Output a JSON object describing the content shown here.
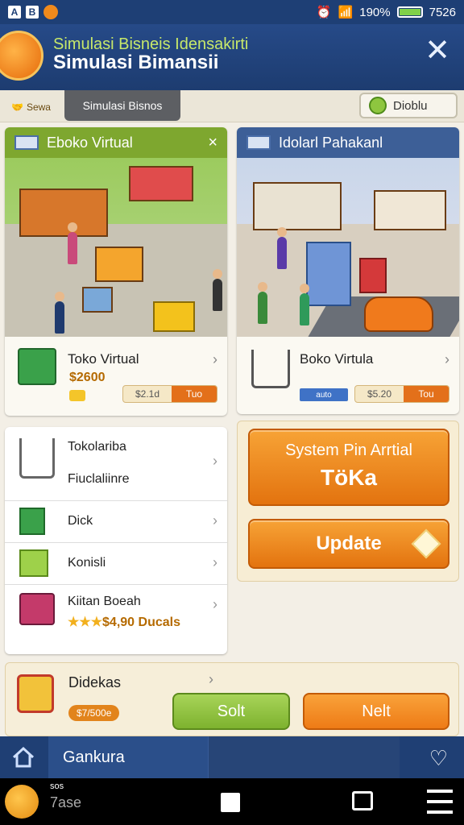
{
  "status": {
    "left_icons": [
      "A",
      "B"
    ],
    "battery_percent": "190%",
    "time": "7526"
  },
  "header": {
    "subtitle": "Simulasi Bisneis Idensakirti",
    "title": "Simulasi Bimansii",
    "close_icon": "close-icon"
  },
  "tabs": {
    "home_label": "Sewa",
    "active_label": "Simulasi Bisnos",
    "right_label": "Dioblu"
  },
  "card_left": {
    "header": "Eboko Virtual",
    "close": "×",
    "product_name": "Toko Virtual",
    "price": "$2600",
    "bar_left": "$2.1d",
    "bar_right": "Tuo"
  },
  "card_right": {
    "header": "Idolarl Pahakanl",
    "product_name": "Boko Virtula",
    "badge": "auto",
    "bar_left": "$5.20",
    "bar_right": "Tou"
  },
  "list": {
    "items": [
      {
        "label": "Tokolariba",
        "icon": "cart-icon"
      },
      {
        "label": "Fiuclaliinre",
        "icon": ""
      },
      {
        "label": "Dick",
        "icon": "box-icon"
      },
      {
        "label": "Konisli",
        "icon": "package-icon"
      },
      {
        "label": "Kiitan Boeah",
        "icon": "register-icon"
      }
    ],
    "rating_text": "$4,90 Ducals",
    "rating_stars": 3
  },
  "side_buttons": {
    "primary_line1": "System Pin Arrtial",
    "primary_line2": "TöKa",
    "secondary": "Update"
  },
  "bottom": {
    "label": "Didekas",
    "price_badge": "$7/500e",
    "green_button": "Solt",
    "orange_button": "Nelt"
  },
  "navbar": {
    "section_label": "Gankura"
  },
  "sysnav": {
    "small": "sos",
    "large": "7ase"
  },
  "colors": {
    "header_blue": "#1e3f75",
    "accent_orange": "#e3730f",
    "accent_green": "#7ea72f"
  }
}
